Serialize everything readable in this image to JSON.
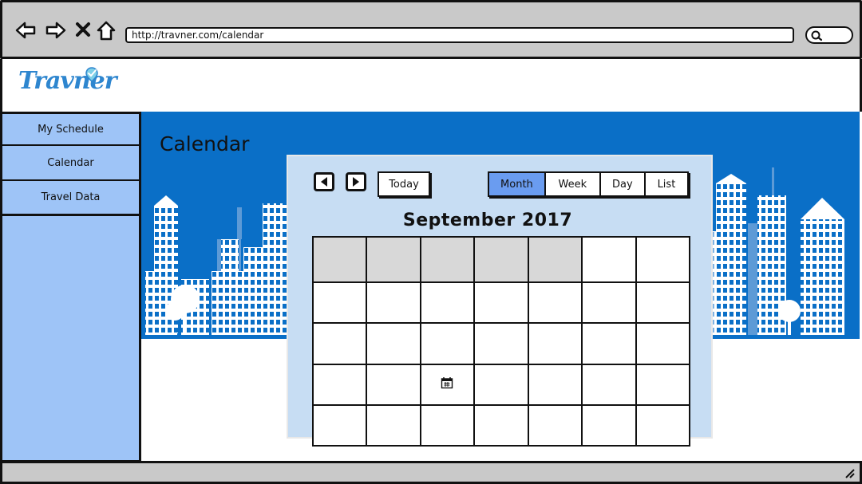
{
  "browser": {
    "url": "http://travner.com/calendar"
  },
  "brand": {
    "logo_text": "Travner",
    "color": "#2e86cf"
  },
  "sidebar": {
    "items": [
      {
        "label": "My Schedule"
      },
      {
        "label": "Calendar"
      },
      {
        "label": "Travel Data"
      }
    ]
  },
  "main": {
    "title": "Calendar",
    "calendar": {
      "today_label": "Today",
      "views": [
        {
          "label": "Month",
          "active": true
        },
        {
          "label": "Week",
          "active": false
        },
        {
          "label": "Day",
          "active": false
        },
        {
          "label": "List",
          "active": false
        }
      ],
      "month_title": "September 2017",
      "rows": 5,
      "cols": 7,
      "disabled_first_row_cells": 5,
      "event_icon": "calendar-icon"
    }
  },
  "colors": {
    "sidebar": "#9ec4f7",
    "main_bg": "#0a6fc7",
    "active_view": "#6a9cf0"
  }
}
